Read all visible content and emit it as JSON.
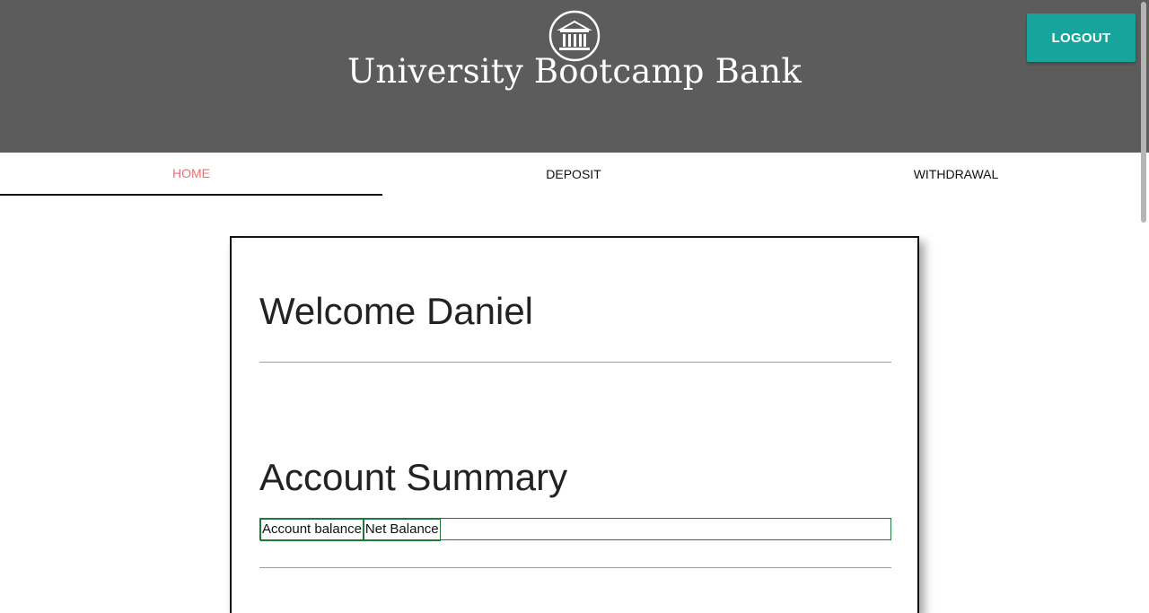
{
  "header": {
    "logo_icon": "bank-building-icon",
    "title": "University Bootcamp Bank",
    "logout_label": "LOGOUT",
    "background_color": "#5c5c5c",
    "logout_color": "#17a59b"
  },
  "nav": {
    "tabs": [
      {
        "label": "HOME",
        "active": true
      },
      {
        "label": "DEPOSIT",
        "active": false
      },
      {
        "label": "WITHDRAWAL",
        "active": false
      }
    ],
    "active_color": "#ee6e73"
  },
  "card": {
    "welcome": "Welcome Daniel",
    "summary_title": "Account Summary",
    "table": {
      "cells": [
        "Account balance",
        "Net Balance"
      ]
    }
  }
}
